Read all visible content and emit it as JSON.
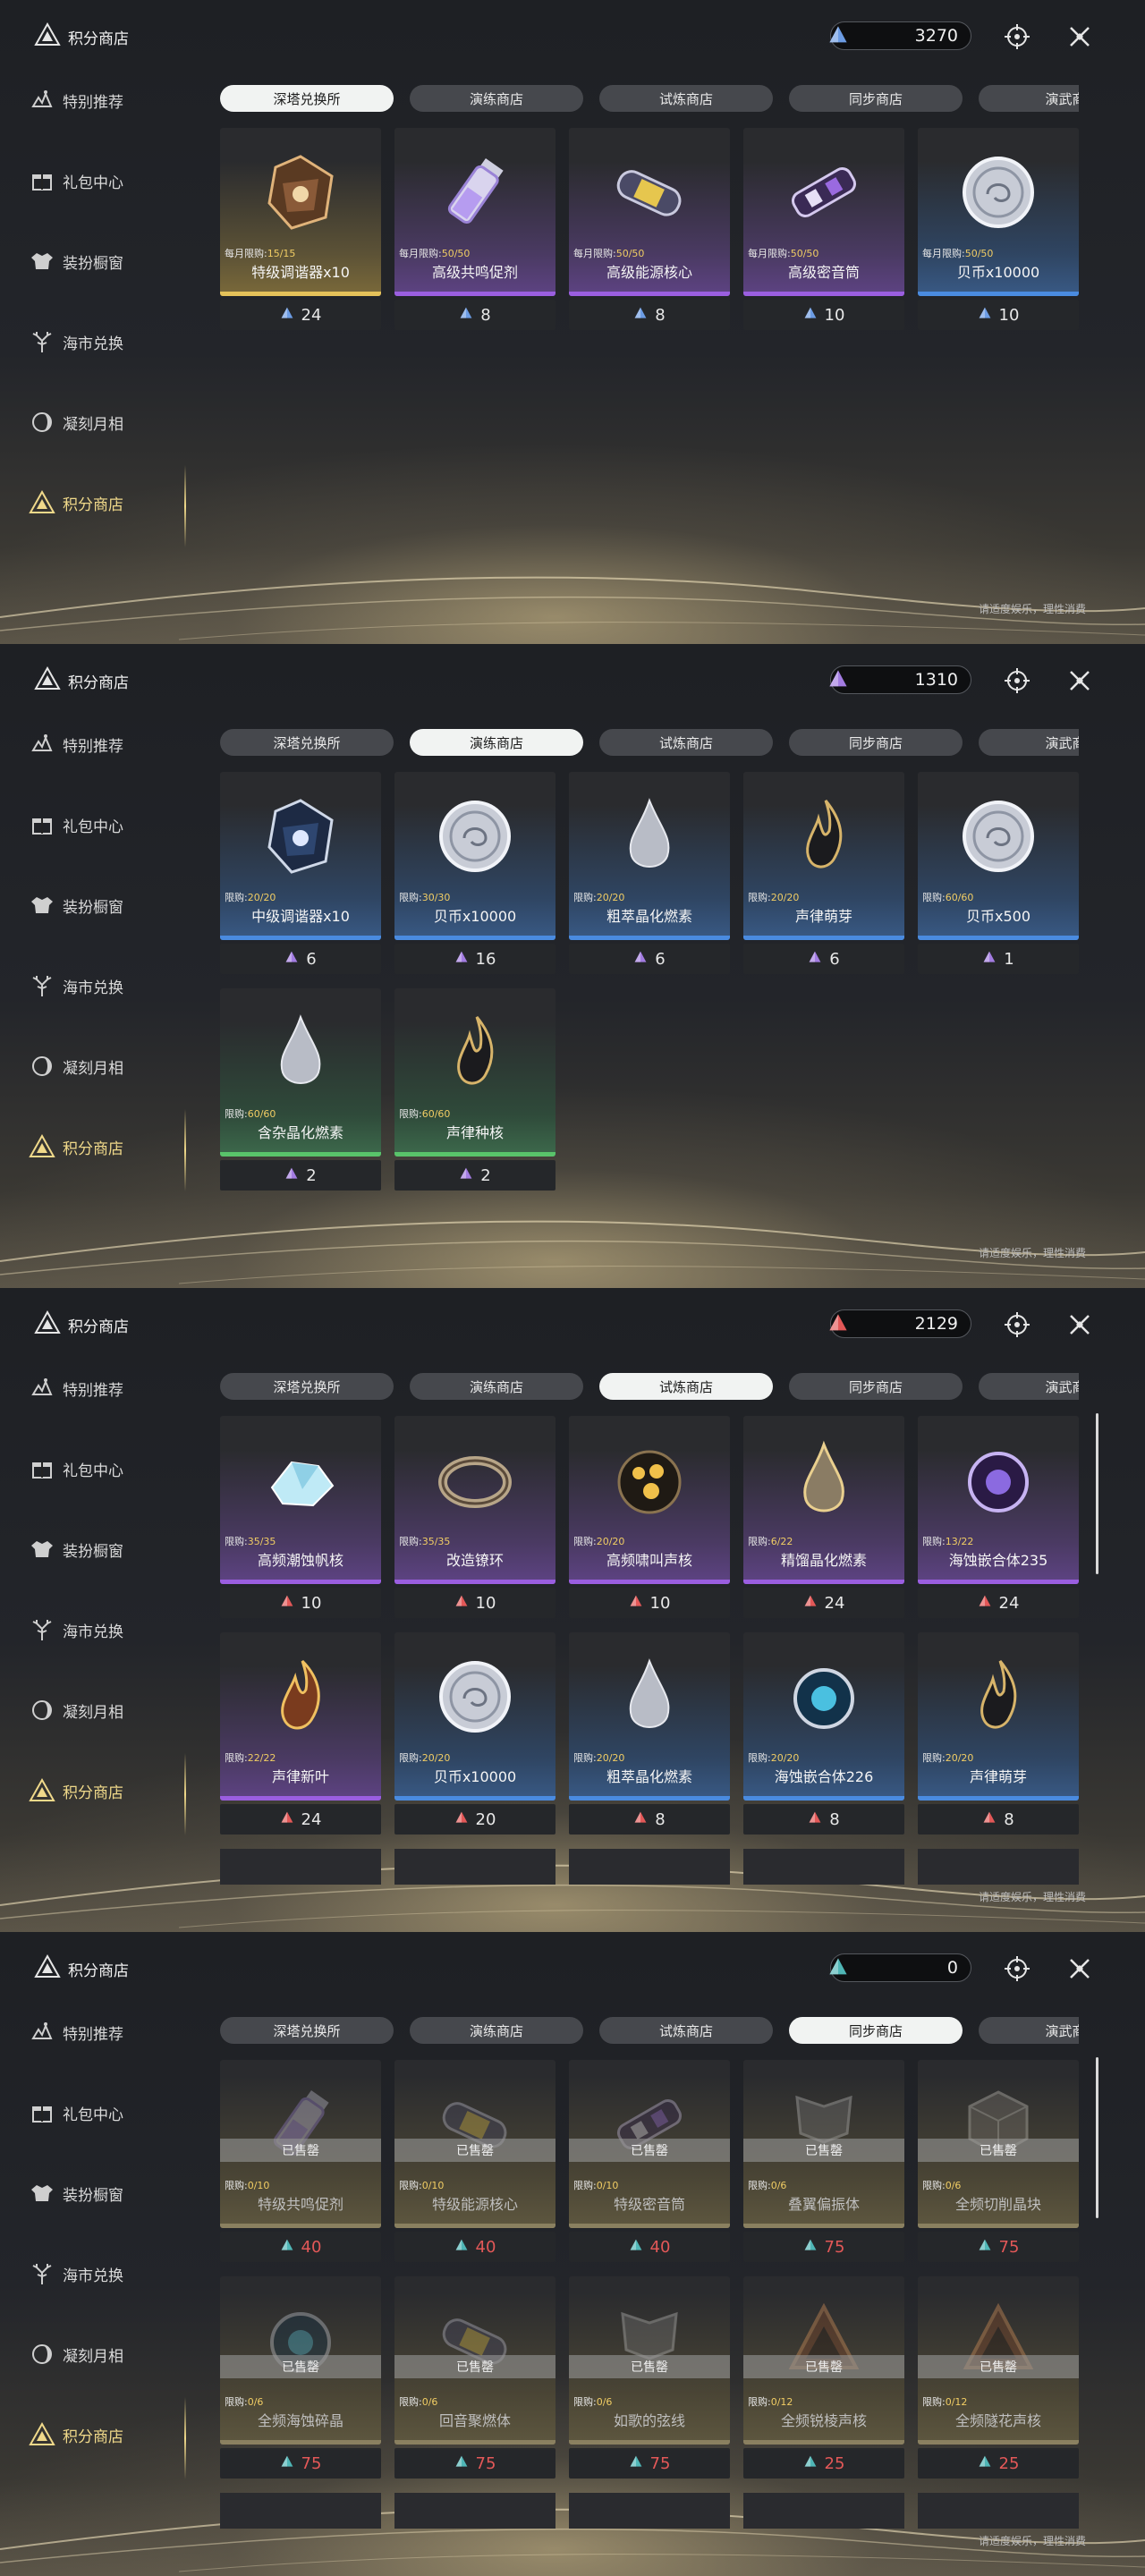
{
  "sidebar": {
    "title": "积分商店",
    "items": [
      {
        "label": "特别推荐",
        "icon": "recommend-icon"
      },
      {
        "label": "礼包中心",
        "icon": "gift-icon"
      },
      {
        "label": "装扮橱窗",
        "icon": "outfit-icon"
      },
      {
        "label": "海市兑换",
        "icon": "coral-icon"
      },
      {
        "label": "凝刻月相",
        "icon": "moon-icon"
      },
      {
        "label": "积分商店",
        "icon": "points-shop-icon",
        "active": true
      }
    ]
  },
  "tabs": [
    "深塔兑换所",
    "演练商店",
    "试炼商店",
    "同步商店",
    "演武商"
  ],
  "notice": "请适度娱乐，理性消费",
  "colors": {
    "gold": "#f0d98a",
    "blue_currency": "#6c9ce4",
    "purple_currency": "#a37ce2",
    "red_currency": "#e35858",
    "teal_currency": "#4fb6b6"
  },
  "screens": [
    {
      "active_tab": 0,
      "currency": {
        "value": "3270",
        "color": "#6c9ce4"
      },
      "items": [
        {
          "name": "特级调谐器x10",
          "limit_label": "每月限购:",
          "limit": "15/15",
          "price": "24",
          "rarity": "gold",
          "art": "tuner-gold"
        },
        {
          "name": "高级共鸣促剂",
          "limit_label": "每月限购:",
          "limit": "50/50",
          "price": "8",
          "rarity": "purple",
          "art": "vial"
        },
        {
          "name": "高级能源核心",
          "limit_label": "每月限购:",
          "limit": "50/50",
          "price": "8",
          "rarity": "purple",
          "art": "capsule"
        },
        {
          "name": "高级密音筒",
          "limit_label": "每月限购:",
          "limit": "50/50",
          "price": "10",
          "rarity": "purple",
          "art": "tube"
        },
        {
          "name": "贝币x10000",
          "limit_label": "每月限购:",
          "limit": "50/50",
          "price": "10",
          "rarity": "blue",
          "art": "coin"
        }
      ]
    },
    {
      "active_tab": 1,
      "currency": {
        "value": "1310",
        "color": "#a37ce2"
      },
      "items": [
        {
          "name": "中级调谐器x10",
          "limit_label": "限购:",
          "limit": "20/20",
          "price": "6",
          "rarity": "blue",
          "art": "tuner-blue"
        },
        {
          "name": "贝币x10000",
          "limit_label": "限购:",
          "limit": "30/30",
          "price": "16",
          "rarity": "blue",
          "art": "coin"
        },
        {
          "name": "粗萃晶化燃素",
          "limit_label": "限购:",
          "limit": "20/20",
          "price": "6",
          "rarity": "blue",
          "art": "drop"
        },
        {
          "name": "声律萌芽",
          "limit_label": "限购:",
          "limit": "20/20",
          "price": "6",
          "rarity": "blue",
          "art": "flame-dark"
        },
        {
          "name": "贝币x500",
          "limit_label": "限购:",
          "limit": "60/60",
          "price": "1",
          "rarity": "blue",
          "art": "coin"
        },
        {
          "name": "含杂晶化燃素",
          "limit_label": "限购:",
          "limit": "60/60",
          "price": "2",
          "rarity": "green",
          "art": "drop"
        },
        {
          "name": "声律种核",
          "limit_label": "限购:",
          "limit": "60/60",
          "price": "2",
          "rarity": "green",
          "art": "flame-dark"
        }
      ]
    },
    {
      "active_tab": 2,
      "currency": {
        "value": "2129",
        "color": "#e35858"
      },
      "items": [
        {
          "name": "高频潮蚀帆核",
          "limit_label": "限购:",
          "limit": "35/35",
          "price": "10",
          "rarity": "purple",
          "art": "crystal"
        },
        {
          "name": "改造镣环",
          "limit_label": "限购:",
          "limit": "35/35",
          "price": "10",
          "rarity": "purple",
          "art": "ring"
        },
        {
          "name": "高频啸叫声核",
          "limit_label": "限购:",
          "limit": "20/20",
          "price": "10",
          "rarity": "purple",
          "art": "orb-gold"
        },
        {
          "name": "精馏晶化燃素",
          "limit_label": "限购:",
          "limit": "6/22",
          "price": "24",
          "rarity": "purple",
          "art": "drop-gold"
        },
        {
          "name": "海蚀嵌合体235",
          "limit_label": "限购:",
          "limit": "13/22",
          "price": "24",
          "rarity": "purple",
          "art": "orb-purple"
        },
        {
          "name": "声律新叶",
          "limit_label": "限购:",
          "limit": "22/22",
          "price": "24",
          "rarity": "purple",
          "art": "flame-gold"
        },
        {
          "name": "贝币x10000",
          "limit_label": "限购:",
          "limit": "20/20",
          "price": "20",
          "rarity": "blue",
          "art": "coin"
        },
        {
          "name": "粗萃晶化燃素",
          "limit_label": "限购:",
          "limit": "20/20",
          "price": "8",
          "rarity": "blue",
          "art": "drop"
        },
        {
          "name": "海蚀嵌合体226",
          "limit_label": "限购:",
          "limit": "20/20",
          "price": "8",
          "rarity": "blue",
          "art": "orb-blue"
        },
        {
          "name": "声律萌芽",
          "limit_label": "限购:",
          "limit": "20/20",
          "price": "8",
          "rarity": "blue",
          "art": "flame-dark"
        }
      ]
    },
    {
      "active_tab": 3,
      "currency": {
        "value": "0",
        "color": "#4fb6b6"
      },
      "sold_label": "已售罄",
      "items": [
        {
          "name": "特级共鸣促剂",
          "limit_label": "限购:",
          "limit": "0/10",
          "price": "40",
          "rarity": "olive",
          "art": "vial"
        },
        {
          "name": "特级能源核心",
          "limit_label": "限购:",
          "limit": "0/10",
          "price": "40",
          "rarity": "olive",
          "art": "capsule"
        },
        {
          "name": "特级密音筒",
          "limit_label": "限购:",
          "limit": "0/10",
          "price": "40",
          "rarity": "olive",
          "art": "tube"
        },
        {
          "name": "叠翼偏振体",
          "limit_label": "限购:",
          "limit": "0/6",
          "price": "75",
          "rarity": "olive",
          "art": "wing"
        },
        {
          "name": "全频切削晶块",
          "limit_label": "限购:",
          "limit": "0/6",
          "price": "75",
          "rarity": "olive",
          "art": "cube"
        },
        {
          "name": "全频海蚀碎晶",
          "limit_label": "限购:",
          "limit": "0/6",
          "price": "75",
          "rarity": "olive",
          "art": "orb-blue"
        },
        {
          "name": "回音聚燃体",
          "limit_label": "限购:",
          "limit": "0/6",
          "price": "75",
          "rarity": "olive",
          "art": "capsule"
        },
        {
          "name": "如歌的弦线",
          "limit_label": "限购:",
          "limit": "0/6",
          "price": "75",
          "rarity": "olive",
          "art": "wing"
        },
        {
          "name": "全频锐棱声核",
          "limit_label": "限购:",
          "limit": "0/12",
          "price": "25",
          "rarity": "olive",
          "art": "prism"
        },
        {
          "name": "全频隧花声核",
          "limit_label": "限购:",
          "limit": "0/12",
          "price": "25",
          "rarity": "olive",
          "art": "prism"
        }
      ]
    }
  ]
}
